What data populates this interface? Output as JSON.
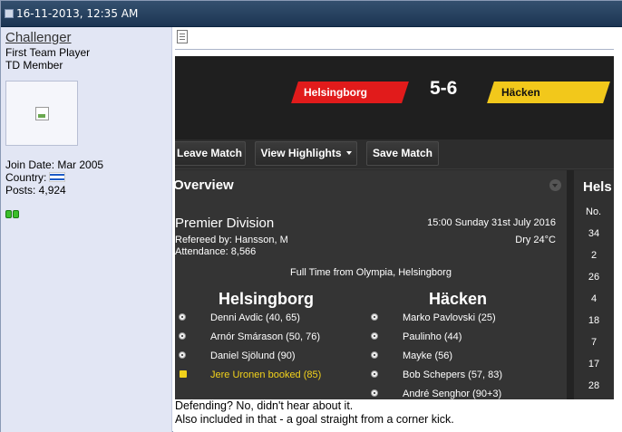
{
  "post": {
    "header_datetime": "16-11-2013, 12:35 AM",
    "text_line1": "Defending? No, didn't hear about it.",
    "text_line2": "Also included in that - a goal straight from a corner kick."
  },
  "user": {
    "username": "Challenger",
    "title_line1": "First Team Player",
    "title_line2": "TD Member",
    "join_date": "Join Date: Mar 2005",
    "country_label": "Country:",
    "posts": "Posts: 4,924"
  },
  "game": {
    "home_team": "Helsingborg",
    "score": "5-6",
    "away_team": "Häcken",
    "buttons": {
      "leave": "Leave Match",
      "highlights": "View Highlights",
      "save": "Save Match"
    },
    "overview": {
      "title": "Overview",
      "competition": "Premier Division",
      "kickoff": "15:00 Sunday 31st July 2016",
      "referee": "Refereed by: Hansson, M",
      "attendance": "Attendance: 8,566",
      "weather": "Dry 24°C",
      "full_time": "Full Time from Olympia, Helsingborg",
      "home_name": "Helsingborg",
      "away_name": "Häcken",
      "home_events": [
        "Denni Avdic (40, 65)",
        "Arnór Smárason (50, 76)",
        "Daniel Sjölund (90)",
        "Jere Uronen booked (85)"
      ],
      "away_events": [
        "Marko Pavlovski (25)",
        "Paulinho (44)",
        "Mayke (56)",
        "Bob Schepers (57, 83)",
        "André Senghor (90+3)"
      ]
    },
    "right_panel": {
      "title": "Hels",
      "header": "No.",
      "numbers": [
        "34",
        "2",
        "26",
        "4",
        "18",
        "7",
        "17",
        "28"
      ]
    }
  },
  "icons": [
    "post-icon",
    "document-icon",
    "flag-icon",
    "online-status-icon",
    "dropdown-caret-icon",
    "collapse-arrow-icon",
    "goal-ball-icon",
    "yellow-card-icon"
  ]
}
